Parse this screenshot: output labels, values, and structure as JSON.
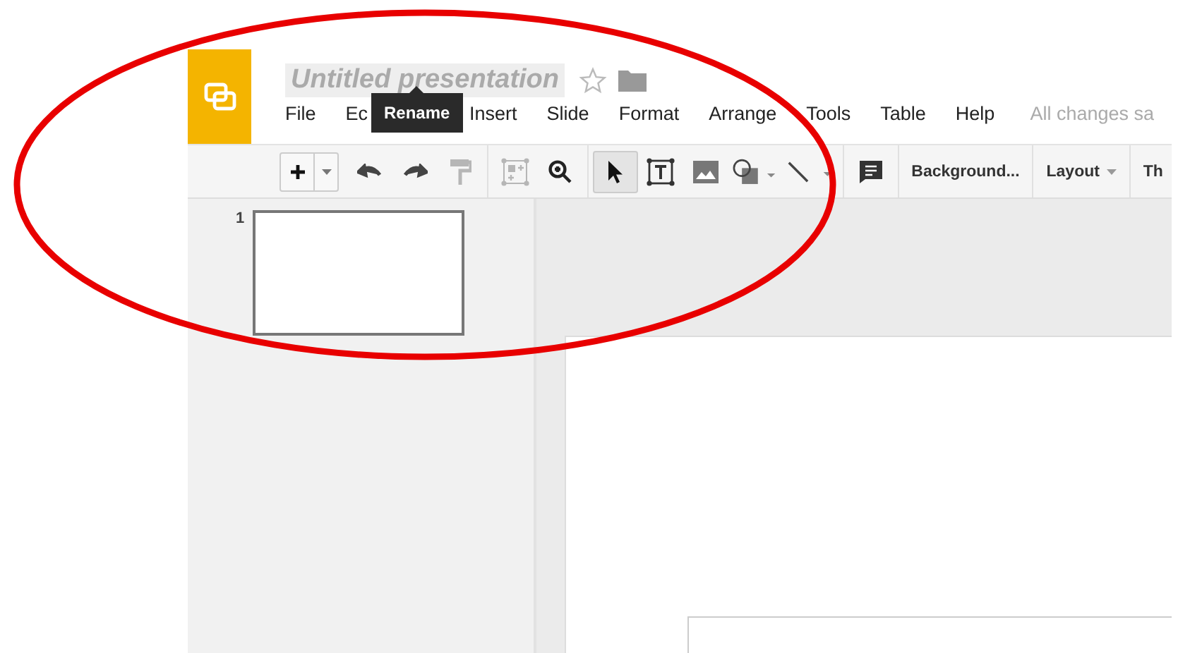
{
  "document": {
    "title": "Untitled presentation",
    "starred": false
  },
  "tooltip": "Rename",
  "menu": [
    {
      "label": "File"
    },
    {
      "label": "Ec"
    },
    {
      "label": "Insert"
    },
    {
      "label": "Slide"
    },
    {
      "label": "Format"
    },
    {
      "label": "Arrange"
    },
    {
      "label": "Tools"
    },
    {
      "label": "Table"
    },
    {
      "label": "Help"
    }
  ],
  "save_status": "All changes sa",
  "toolbar": {
    "tools": [
      {
        "kind": "new-slide",
        "disabled": false,
        "selected": false
      },
      {
        "kind": "undo",
        "disabled": false,
        "selected": false
      },
      {
        "kind": "redo",
        "disabled": false,
        "selected": false
      },
      {
        "kind": "paint-format",
        "disabled": true,
        "selected": false
      },
      {
        "kind": "layout-select",
        "disabled": true,
        "selected": false
      },
      {
        "kind": "zoom",
        "disabled": false,
        "selected": false
      },
      {
        "kind": "select",
        "disabled": false,
        "selected": true
      },
      {
        "kind": "text-box",
        "disabled": false,
        "selected": false
      },
      {
        "kind": "image",
        "disabled": false,
        "selected": false
      },
      {
        "kind": "shape",
        "disabled": false,
        "selected": false
      },
      {
        "kind": "line",
        "disabled": false,
        "selected": false
      },
      {
        "kind": "comment",
        "disabled": false,
        "selected": false
      }
    ],
    "buttons": [
      {
        "label": "Background...",
        "dropdown": false
      },
      {
        "label": "Layout",
        "dropdown": true
      },
      {
        "label": "Th",
        "dropdown": false
      }
    ]
  },
  "slides": [
    {
      "number": "1"
    }
  ]
}
